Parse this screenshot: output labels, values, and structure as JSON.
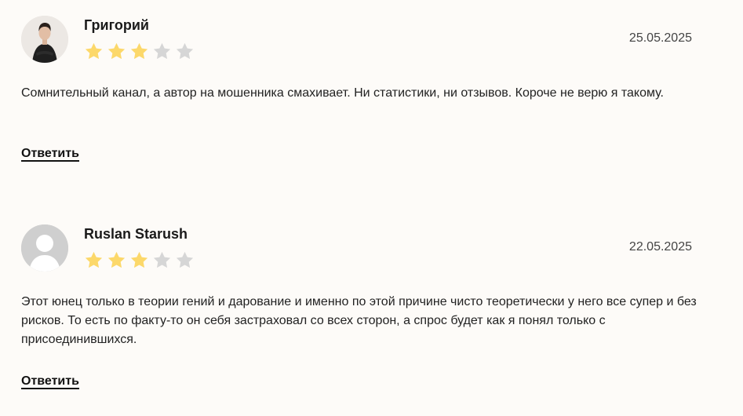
{
  "colors": {
    "star_filled": "#fcd86a",
    "star_empty": "#d6d6d6",
    "background": "#fdfbf8"
  },
  "reviews": [
    {
      "author": "Григорий",
      "date": "25.05.2025",
      "rating": 3,
      "max_rating": 5,
      "avatar": "user-photo",
      "text": "Сомнительный канал, а автор на мошенника смахивает. Ни статистики, ни отзывов. Короче не верю я такому.",
      "reply_label": "Ответить"
    },
    {
      "author": "Ruslan Starush",
      "date": "22.05.2025",
      "rating": 3,
      "max_rating": 5,
      "avatar": "default-user-icon",
      "text": "Этот юнец только в теории гений и дарование и именно по этой причине чисто теоретически у него все супер и без рисков. То есть по факту-то он себя застраховал со всех сторон, а спрос будет как я понял только с присоединившихся.",
      "reply_label": "Ответить"
    }
  ]
}
